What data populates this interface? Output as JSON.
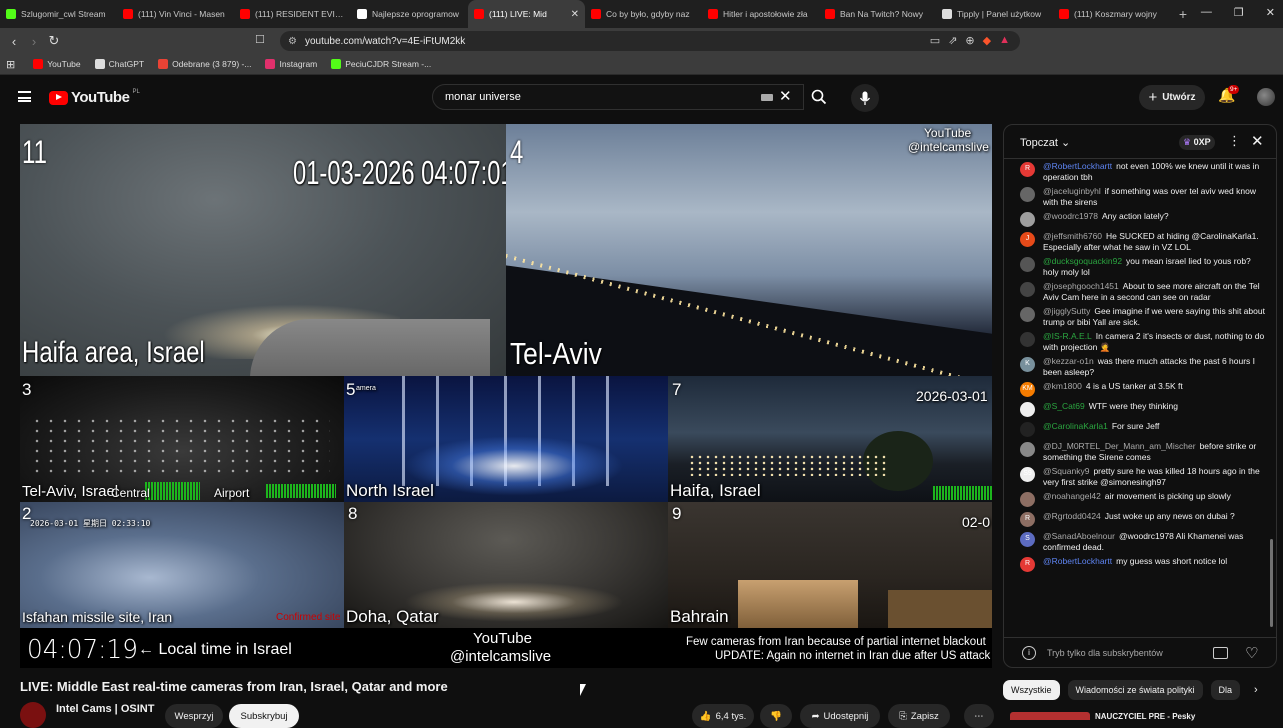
{
  "browser": {
    "tabs": [
      {
        "title": "Szlugomir_cwl Stream",
        "color": "#53fc18"
      },
      {
        "title": "(111) Vin Vinci - Masen",
        "color": "#ff0000"
      },
      {
        "title": "(111) RESIDENT EVIL 9",
        "color": "#ff0000"
      },
      {
        "title": "Najlepsze oprogramow",
        "color": "#ffffff"
      },
      {
        "title": "(111) LIVE: Mid",
        "color": "#ff0000"
      },
      {
        "title": "Co by było, gdyby naz",
        "color": "#ff0000"
      },
      {
        "title": "Hitler i apostołowie zła",
        "color": "#ff0000"
      },
      {
        "title": "Ban Na Twitch? Nowy",
        "color": "#ff0000"
      },
      {
        "title": "Tipply | Panel użytkow",
        "color": "#dddddd"
      },
      {
        "title": "(111) Koszmary wojny",
        "color": "#ff0000"
      }
    ],
    "active_tab": 4,
    "url": "youtube.com/watch?v=4E-iFtUM2kk",
    "bookmarks": [
      {
        "label": "YouTube",
        "color": "#ff0000"
      },
      {
        "label": "ChatGPT",
        "color": "#dddddd"
      },
      {
        "label": "Odebrane (3 879) -...",
        "color": "#ea4335"
      },
      {
        "label": "Instagram",
        "color": "#e1306c"
      },
      {
        "label": "PeciuCJDR Stream -...",
        "color": "#53fc18"
      }
    ]
  },
  "header": {
    "logo": "YouTube",
    "region": "PL",
    "search_value": "monar universe",
    "create_label": "Utwórz",
    "notif_badge": "9+"
  },
  "video": {
    "cams": {
      "c11_num": "11",
      "c11_time": "01-03-2026 04:07:01",
      "c11_label": "Haifa area, Israel",
      "c4_num": "4",
      "c4_wm1": "YouTube",
      "c4_wm2": "@intelcamslive",
      "c4_label": "Tel-Aviv",
      "c3_num": "3",
      "c3_label": "Tel-Aviv, Israel",
      "c3_central": "Central",
      "c3_airport": "Airport",
      "c5_num": "5",
      "c5_sub": "amera",
      "c5_label": "North Israel",
      "c7_num": "7",
      "c7_date": "2026-03-01",
      "c7_label": "Haifa, Israel",
      "c2_num": "2",
      "c2_time": "2026-03-01  星期日  02:33:10",
      "c2_label": "Isfahan missile site, Iran",
      "c2_confirmed": "Confirmed site",
      "c8_num": "8",
      "c8_label": "Doha, Qatar",
      "c9_num": "9",
      "c9_time": "02-0",
      "c9_label": "Bahrain"
    },
    "clock": "04:07:19",
    "clock_note": "← Local time in Israel",
    "wm1": "YouTube",
    "wm2": "@intelcamslive",
    "notice1": "Few cameras from Iran because of partial internet blackout",
    "notice2": "UPDATE: Again no internet in Iran due after US attack"
  },
  "meta": {
    "title": "LIVE: Middle East real-time cameras from Iran, Israel, Qatar and more",
    "channel": "Intel Cams | OSINT",
    "support": "Wesprzyj",
    "subscribe": "Subskrybuj",
    "likes": "6,4 tys.",
    "share": "Udostępnij",
    "save": "Zapisz"
  },
  "chat": {
    "mode": "Topczat",
    "points": "0XP",
    "messages": [
      {
        "author": "@RobertLockhartt",
        "text": "not even 100% we knew until it was in operation tbh",
        "color": "#e53935",
        "initial": "R",
        "cls": "mod"
      },
      {
        "author": "@jaceluginbyhl",
        "text": "if something was over tel aviv wed know with the sirens",
        "color": "#666666",
        "initial": "",
        "cls": ""
      },
      {
        "author": "@woodrc1978",
        "text": "Any action lately?",
        "color": "#9e9e9e",
        "initial": "",
        "cls": ""
      },
      {
        "author": "@jeffsmith6760",
        "text": "He SUCKED at hiding @CarolinaKarla1. Especially after what he saw in VZ LOL",
        "color": "#e64a19",
        "initial": "J",
        "cls": ""
      },
      {
        "author": "@ducksgoquackin92",
        "text": "you mean israel lied to yous rob? holy moly lol",
        "color": "#555555",
        "initial": "",
        "cls": "mem"
      },
      {
        "author": "@josephgooch1451",
        "text": "About to see more aircraft on the Tel Aviv Cam here in a second can see on radar",
        "color": "#444444",
        "initial": "",
        "cls": ""
      },
      {
        "author": "@jigglySutty",
        "text": "Gee imagine if we were saying this shit about trump or bibi Yall are sick.",
        "color": "#666666",
        "initial": "",
        "cls": ""
      },
      {
        "author": "@IS-R.A.E.L",
        "text": "In camera 2 it's insects or dust, nothing to do with projection 🤦",
        "color": "#333333",
        "initial": "",
        "cls": "mem"
      },
      {
        "author": "@kezzar-o1n",
        "text": "was there much attacks the past 6 hours I been asleep?",
        "color": "#78909c",
        "initial": "K",
        "cls": ""
      },
      {
        "author": "@km1800",
        "text": "4 is a US tanker at 3.5K ft",
        "color": "#f57c00",
        "initial": "KM",
        "cls": ""
      },
      {
        "author": "@S_Cat69",
        "text": "WTF were they thinking",
        "color": "#eeeeee",
        "initial": "",
        "cls": "mem"
      },
      {
        "author": "@CarolinaKarla1",
        "text": "For sure Jeff",
        "color": "#222222",
        "initial": "",
        "cls": "mem"
      },
      {
        "author": "@DJ_M0RTEL_Der_Mann_am_Mischer",
        "text": "before strike or something the Sirene comes",
        "color": "#888888",
        "initial": "",
        "cls": ""
      },
      {
        "author": "@Squanky9",
        "text": "pretty sure he was killed 18 hours ago in the very first strike @simonesingh97",
        "color": "#eeeeee",
        "initial": "S9",
        "cls": ""
      },
      {
        "author": "@noahangel42",
        "text": "air movement is picking up slowly",
        "color": "#8d6e63",
        "initial": "",
        "cls": ""
      },
      {
        "author": "@Rgrtodd0424",
        "text": "Just woke up any news on dubai ?",
        "color": "#8d6e63",
        "initial": "R",
        "cls": ""
      },
      {
        "author": "@SanadAboelnour",
        "text": "@woodrc1978 Ali Khamenei was confirmed dead.",
        "color": "#5c6bc0",
        "initial": "S",
        "cls": ""
      },
      {
        "author": "@RobertLockhartt",
        "text": "my guess was short notice lol",
        "color": "#e53935",
        "initial": "R",
        "cls": "mod"
      }
    ],
    "footer_text": "Tryb tylko dla subskrybentów"
  },
  "chips": [
    "Wszystkie",
    "Wiadomości ze świata polityki",
    "Dla"
  ],
  "next_video_title": "NAUCZYCIEL PRE - Pesky"
}
